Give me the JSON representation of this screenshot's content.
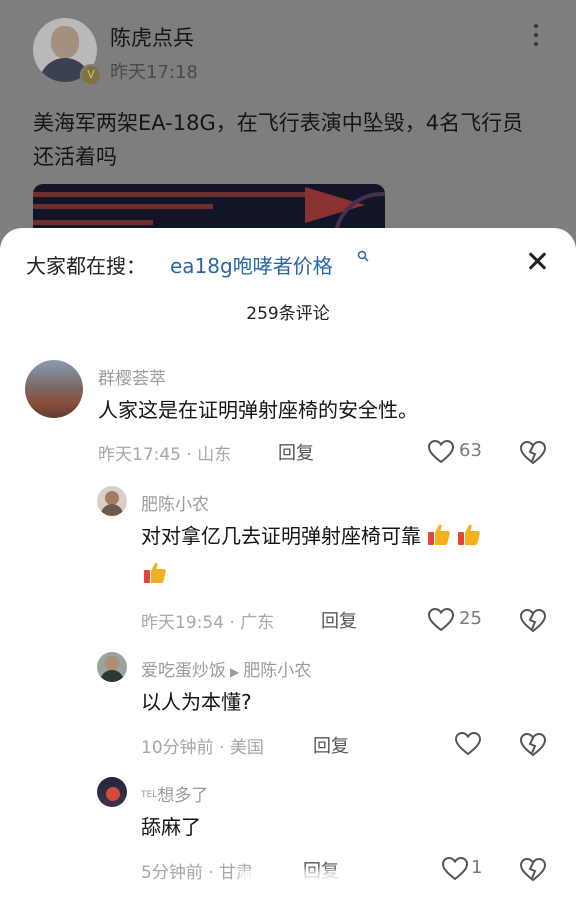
{
  "post": {
    "author_name": "陈虎点兵",
    "time": "昨天17:18",
    "title": "美海军两架EA-18G，在飞行表演中坠毁，4名飞行员还活着吗"
  },
  "sheet": {
    "search_prefix": "大家都在搜：",
    "search_term": "ea18g咆哮者价格",
    "comment_count": "259条评论"
  },
  "comments": [
    {
      "name": "群樱荟萃",
      "text": "人家这是在证明弹射座椅的安全性。",
      "time": "昨天17:45",
      "location": "山东",
      "reply_label": "回复",
      "likes": "63"
    },
    {
      "name": "肥陈小农",
      "text": "对对拿亿几去证明弹射座椅可靠",
      "time": "昨天19:54",
      "location": "广东",
      "reply_label": "回复",
      "likes": "25"
    },
    {
      "name": "爱吃蛋炒饭",
      "reply_to": "肥陈小农",
      "text": "以人为本懂?",
      "time": "10分钟前",
      "location": "美国",
      "reply_label": "回复",
      "likes": ""
    },
    {
      "name": "想多了",
      "name_prefix": "TEL",
      "text": "舔麻了",
      "time": "5分钟前",
      "location": "甘肃",
      "reply_label": "回复",
      "likes": "1"
    }
  ],
  "colors": {
    "link": "#2966a8",
    "thumb_emoji": "#f5a623"
  },
  "icons": [
    "more-icon",
    "close-icon",
    "search-icon",
    "heart-icon",
    "broken-heart-icon",
    "thumbs-up-emoji",
    "verified-badge-icon"
  ]
}
